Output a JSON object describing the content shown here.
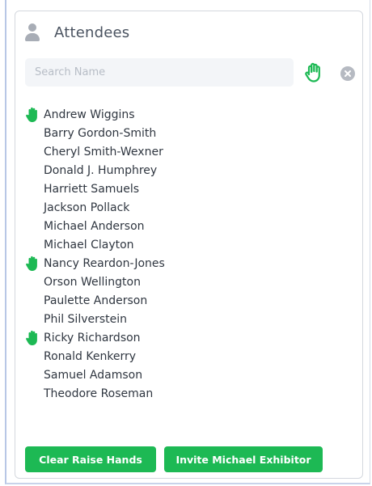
{
  "panel": {
    "title": "Attendees",
    "search_placeholder": "Search Name",
    "accent_color": "#1db954"
  },
  "attendees": [
    {
      "name": "Andrew Wiggins",
      "hand_raised": true
    },
    {
      "name": "Barry Gordon-Smith",
      "hand_raised": false
    },
    {
      "name": "Cheryl Smith-Wexner",
      "hand_raised": false
    },
    {
      "name": "Donald J. Humphrey",
      "hand_raised": false
    },
    {
      "name": "Harriett Samuels",
      "hand_raised": false
    },
    {
      "name": "Jackson Pollack",
      "hand_raised": false
    },
    {
      "name": "Michael Anderson",
      "hand_raised": false
    },
    {
      "name": "Michael Clayton",
      "hand_raised": false
    },
    {
      "name": "Nancy Reardon-Jones",
      "hand_raised": true
    },
    {
      "name": "Orson Wellington",
      "hand_raised": false
    },
    {
      "name": "Paulette Anderson",
      "hand_raised": false
    },
    {
      "name": "Phil Silverstein",
      "hand_raised": false
    },
    {
      "name": "Ricky Richardson",
      "hand_raised": true
    },
    {
      "name": "Ronald Kenkerry",
      "hand_raised": false
    },
    {
      "name": "Samuel Adamson",
      "hand_raised": false
    },
    {
      "name": "Theodore Roseman",
      "hand_raised": false
    }
  ],
  "buttons": {
    "clear_raise_hands": "Clear Raise Hands",
    "invite": "Invite Michael Exhibitor"
  },
  "icons": {
    "header": "user-icon",
    "raise_hand_filter": "hand-outline-icon",
    "clear_search": "close-circle-icon",
    "raised_hand": "hand-icon"
  }
}
